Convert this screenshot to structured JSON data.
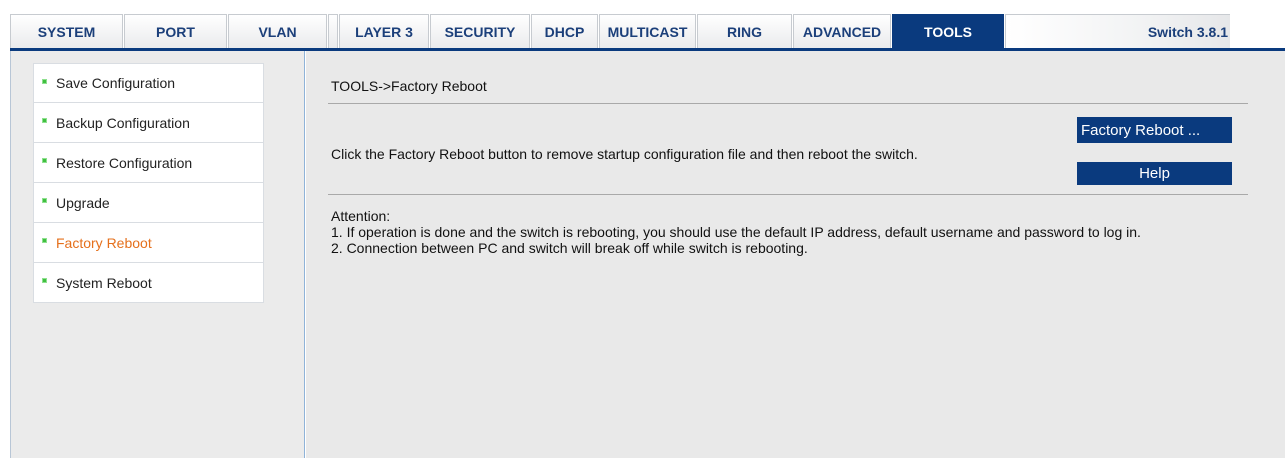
{
  "nav": {
    "tabs": [
      {
        "label": "SYSTEM"
      },
      {
        "label": "PORT"
      },
      {
        "label": "VLAN"
      },
      {
        "label": "LAYER 3"
      },
      {
        "label": "SECURITY"
      },
      {
        "label": "DHCP"
      },
      {
        "label": "MULTICAST"
      },
      {
        "label": "RING"
      },
      {
        "label": "ADVANCED"
      },
      {
        "label": "TOOLS"
      }
    ],
    "active_tab": "TOOLS",
    "version": "Switch 3.8.1"
  },
  "sidebar": {
    "items": [
      {
        "label": "Save Configuration"
      },
      {
        "label": "Backup Configuration"
      },
      {
        "label": "Restore Configuration"
      },
      {
        "label": "Upgrade"
      },
      {
        "label": "Factory Reboot"
      },
      {
        "label": "System Reboot"
      }
    ],
    "active_item": "Factory Reboot"
  },
  "main": {
    "breadcrumb": "TOOLS->Factory Reboot",
    "description": "Click the Factory Reboot button to remove startup configuration file and then reboot the switch.",
    "factory_reboot_button": "Factory Reboot ...",
    "help_button": "Help",
    "attention_title": "Attention:",
    "attention_lines": [
      "1. If operation is done and the switch is rebooting, you should use the default IP address, default username and password to log in.",
      "2. Connection between PC and switch will break off while switch is rebooting."
    ]
  },
  "colors": {
    "brand_navy": "#0a3a7e",
    "active_menu_text": "#e5701c",
    "bullet_green": "#3fbf3f"
  }
}
